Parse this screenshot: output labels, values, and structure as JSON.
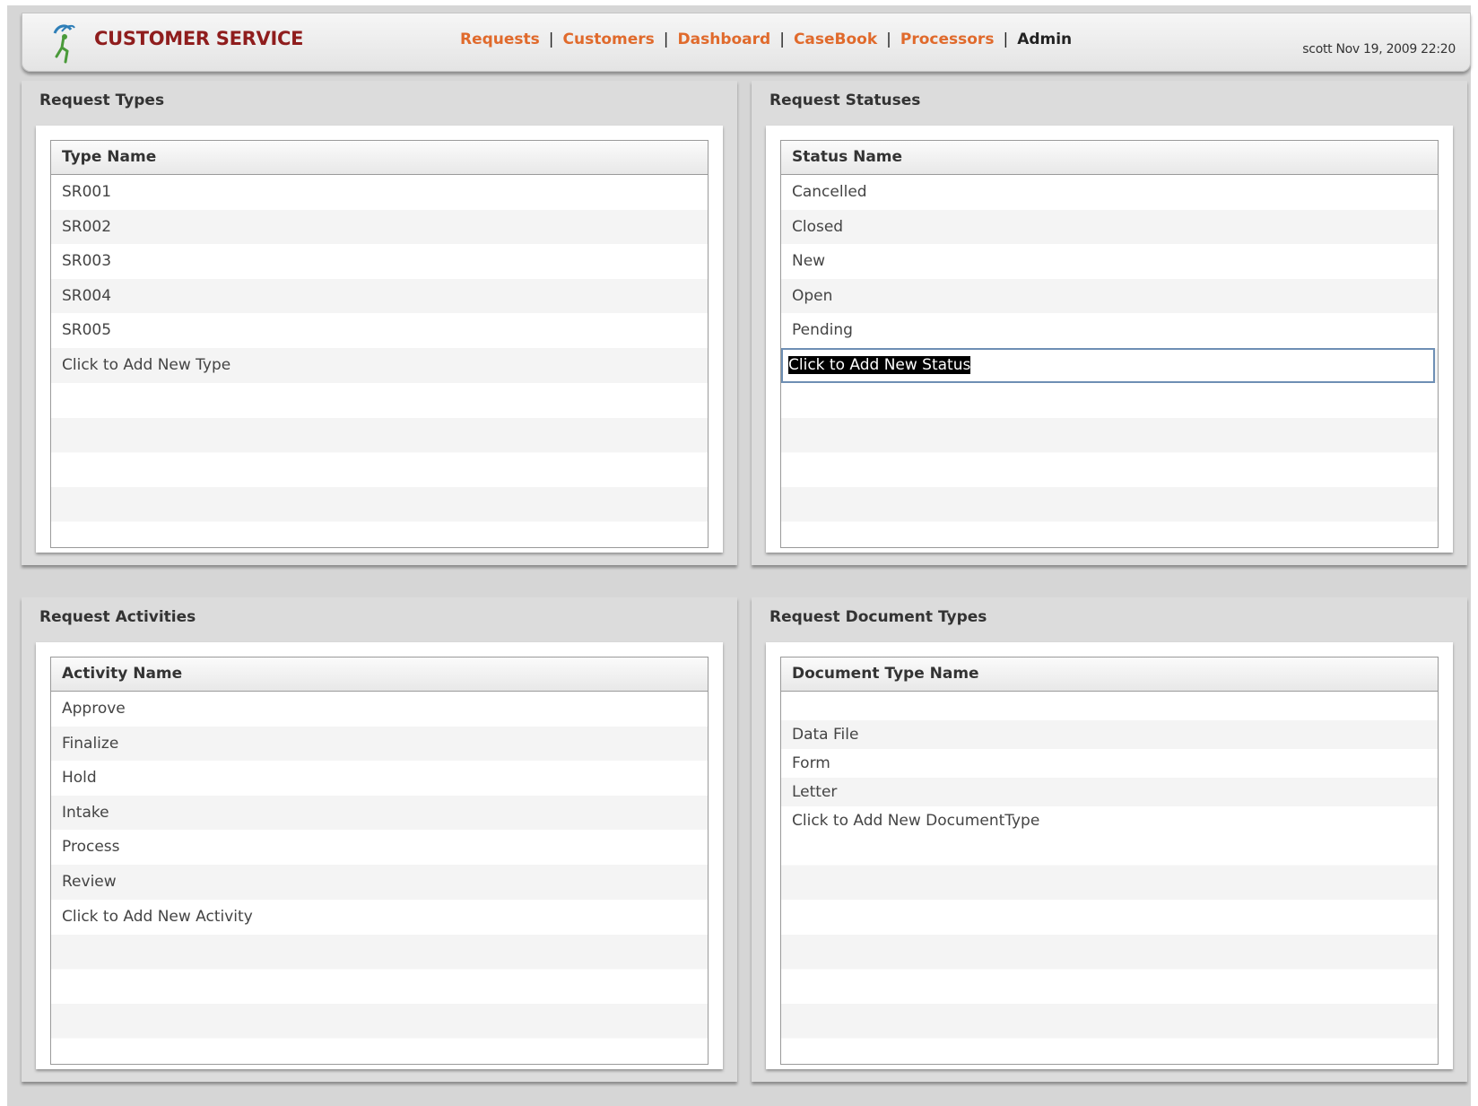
{
  "header": {
    "app_title": "CUSTOMER SERVICE",
    "nav": [
      {
        "label": "Requests"
      },
      {
        "label": "Customers"
      },
      {
        "label": "Dashboard"
      },
      {
        "label": "CaseBook"
      },
      {
        "label": "Processors"
      },
      {
        "label": "Admin",
        "active": true
      }
    ],
    "nav_separator": "|",
    "user_info": "scott Nov 19, 2009 22:20"
  },
  "panels": {
    "types": {
      "title": "Request Types",
      "column": "Type Name",
      "rows": [
        "SR001",
        "SR002",
        "SR003",
        "SR004",
        "SR005",
        "Click to Add New Type"
      ]
    },
    "statuses": {
      "title": "Request Statuses",
      "column": "Status Name",
      "rows": [
        "Cancelled",
        "Closed",
        "New",
        "Open",
        "Pending"
      ],
      "editing_value": "Click to Add New Status"
    },
    "activities": {
      "title": "Request Activities",
      "column": "Activity Name",
      "rows": [
        "Approve",
        "Finalize",
        "Hold",
        "Intake",
        "Process",
        "Review",
        "Click to Add New Activity"
      ]
    },
    "doctypes": {
      "title": "Request Document Types",
      "column": "Document Type Name",
      "rows": [
        "",
        "Data File",
        "Form",
        "Letter",
        "Click to Add New DocumentType"
      ]
    }
  },
  "colors": {
    "brand": "#8f1d1d",
    "nav_link": "#e06a2c",
    "nav_active": "#222222"
  }
}
